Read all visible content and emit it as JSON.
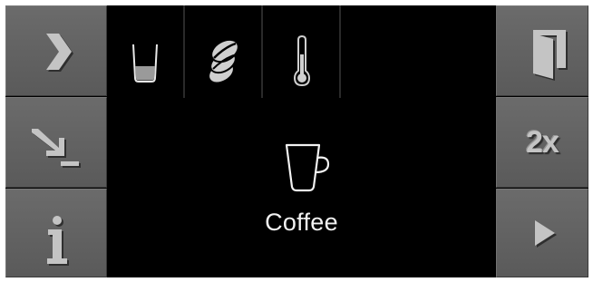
{
  "colors": {
    "button_face": "#636363",
    "glyph": "#c4c4c4",
    "screen_background": "#000000",
    "screen_text": "#f2f2f2"
  },
  "left_column": [
    {
      "name": "next-button",
      "icon": "chevron-right-icon"
    },
    {
      "name": "insert-button",
      "icon": "arrow-down-right-icon"
    },
    {
      "name": "info-button",
      "icon": "info-icon",
      "text": "i"
    }
  ],
  "right_column": [
    {
      "name": "door-button",
      "icon": "door-icon"
    },
    {
      "name": "double-shot-button",
      "icon": "double-icon",
      "text": "2x"
    },
    {
      "name": "start-button",
      "icon": "play-icon"
    }
  ],
  "tabs": [
    {
      "name": "tab-cup-size",
      "icon": "glass-icon"
    },
    {
      "name": "tab-coffee-strength",
      "icon": "coffee-beans-icon"
    },
    {
      "name": "tab-temperature",
      "icon": "thermometer-icon"
    },
    {
      "name": "tab-empty",
      "icon": ""
    }
  ],
  "main": {
    "product_icon": "coffee-cup-icon",
    "product_name": "Coffee"
  }
}
